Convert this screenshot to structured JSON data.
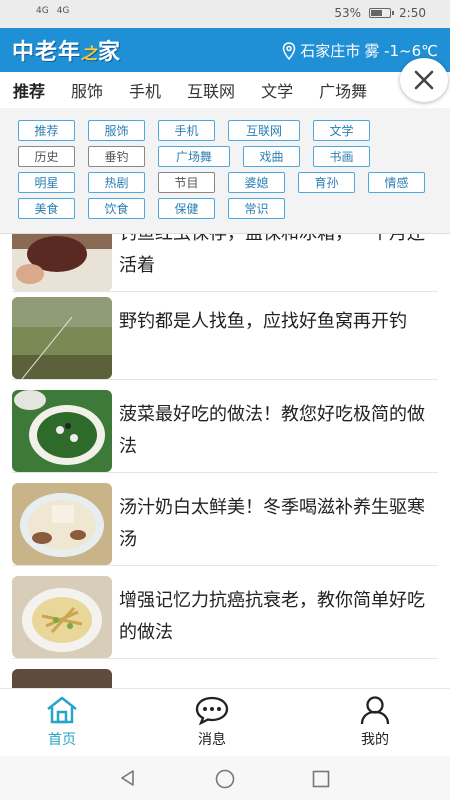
{
  "status": {
    "signal_left": "4G",
    "signal_right": "4G",
    "battery": "53%",
    "time": "2:50"
  },
  "header": {
    "logo_main": "中老年",
    "logo_accent": "之",
    "logo_end": "家",
    "city": "石家庄市",
    "weather": "雾 -1~6℃"
  },
  "tabs": [
    {
      "label": "推荐"
    },
    {
      "label": "服饰"
    },
    {
      "label": "手机"
    },
    {
      "label": "互联网"
    },
    {
      "label": "文学"
    },
    {
      "label": "广场舞"
    }
  ],
  "tags": [
    {
      "label": "推荐"
    },
    {
      "label": "服饰"
    },
    {
      "label": "手机"
    },
    {
      "label": "互联网"
    },
    {
      "label": "文学"
    },
    {
      "label": "历史"
    },
    {
      "label": "垂钓"
    },
    {
      "label": "广场舞"
    },
    {
      "label": "戏曲"
    },
    {
      "label": "书画"
    },
    {
      "label": "明星"
    },
    {
      "label": "热剧"
    },
    {
      "label": "节目"
    },
    {
      "label": "婆媳"
    },
    {
      "label": "育孙"
    },
    {
      "label": "情感"
    },
    {
      "label": "美食"
    },
    {
      "label": "饮食"
    },
    {
      "label": "保健"
    },
    {
      "label": "常识"
    }
  ],
  "articles": [
    {
      "title": "钓鱼红虫保存，盐保和冰箱，一个月还活着"
    },
    {
      "title": "野钓都是人找鱼，应找好鱼窝再开钓"
    },
    {
      "title": "菠菜最好吃的做法！教您好吃极简的做法"
    },
    {
      "title": "汤汁奶白太鲜美！冬季喝滋补养生驱寒汤"
    },
    {
      "title": "增强记忆力抗癌抗衰老，教你简单好吃的做法"
    }
  ],
  "nav": {
    "home": "首页",
    "messages": "消息",
    "mine": "我的"
  },
  "colors": {
    "brand": "#1f8fd6",
    "tag_border": "#4fa8db",
    "active_nav": "#26a5c9"
  }
}
